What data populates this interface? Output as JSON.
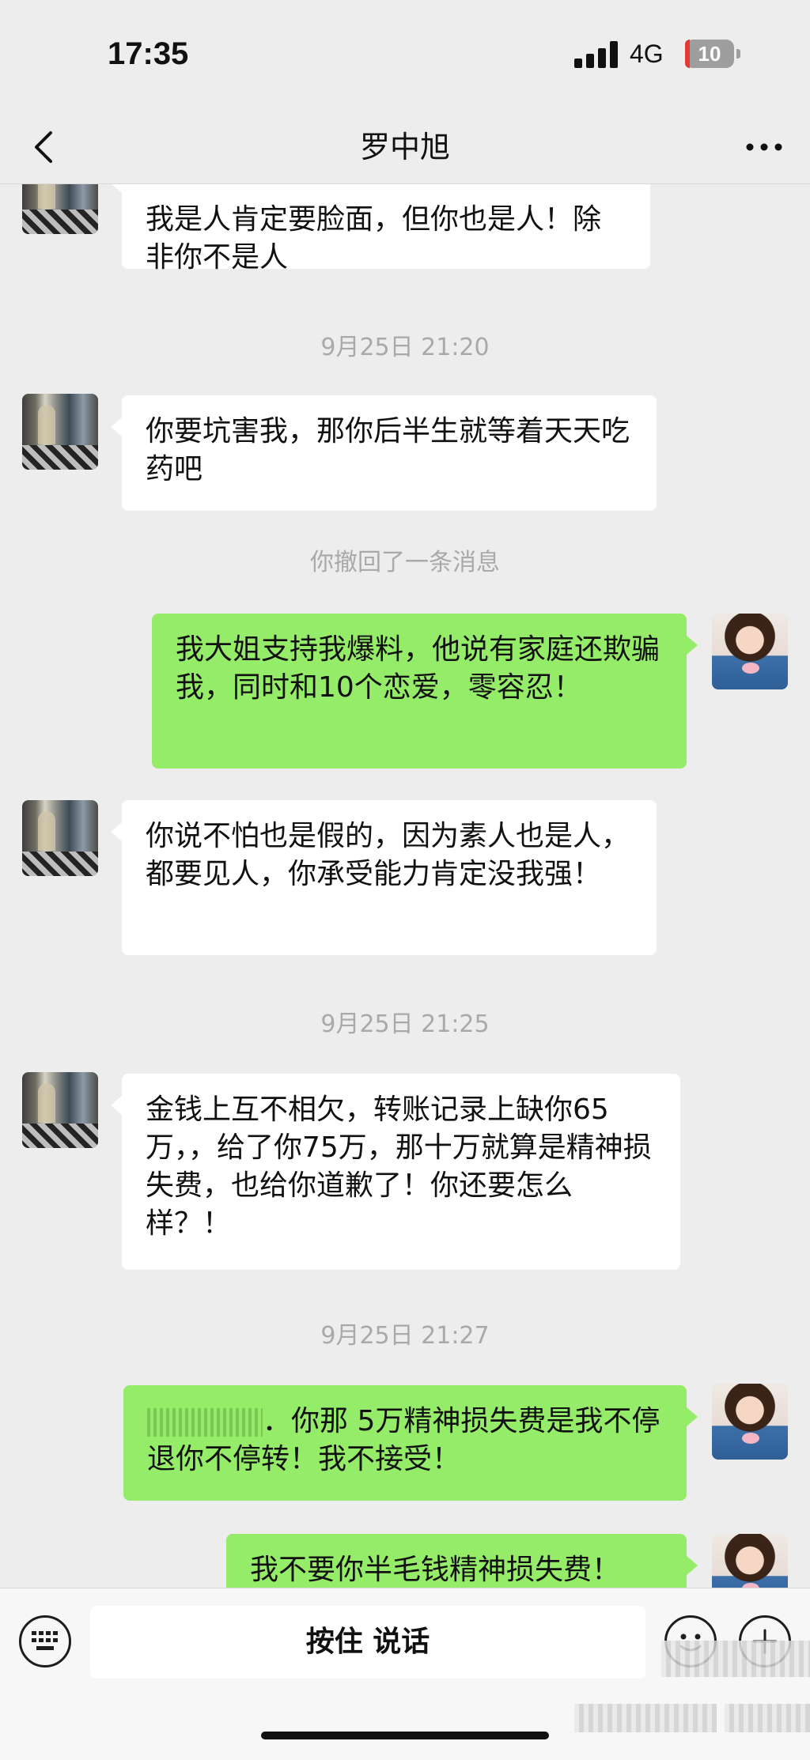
{
  "status_bar": {
    "time": "17:35",
    "network": "4G",
    "battery": "10",
    "battery_level_percent": 10
  },
  "nav": {
    "title": "罗中旭",
    "back_icon": "chevron-left-icon",
    "more_icon": "more-dots-icon"
  },
  "chat": {
    "messages": [
      {
        "side": "left",
        "text": "我是人肯定要脸面，但你也是人！除非你不是人"
      },
      {
        "timestamp": "9月25日 21:20"
      },
      {
        "side": "left",
        "text": "你要坑害我，那你后半生就等着天天吃药吧"
      },
      {
        "system": "你撤回了一条消息"
      },
      {
        "side": "right",
        "text": "我大姐支持我爆料，他说有家庭还欺骗我，同时和10个恋爱，零容忍！"
      },
      {
        "side": "left",
        "text": "你说不怕也是假的，因为素人也是人，都要见人，你承受能力肯定没我强！"
      },
      {
        "timestamp": "9月25日 21:25"
      },
      {
        "side": "left",
        "text": "金钱上互不相欠，转账记录上缺你65万，，给了你75万，那十万就算是精神损失费，也给你道歉了！你还要怎么样？！"
      },
      {
        "timestamp": "9月25日 21:27"
      },
      {
        "side": "right",
        "text": "．你那 5万精神损失费是我不停退你不停转！我不接受！"
      },
      {
        "side": "right",
        "text": "我不要你半毛钱精神损失费！"
      }
    ]
  },
  "input_bar": {
    "hold_to_talk_label": "按住 说话",
    "keyboard_icon": "keyboard-icon",
    "emoji_icon": "emoji-icon",
    "plus_icon": "plus-icon"
  },
  "colors": {
    "background": "#ededed",
    "bubble_left": "#ffffff",
    "bubble_right": "#95ec69",
    "timestamp_text": "#a9a9a9"
  }
}
